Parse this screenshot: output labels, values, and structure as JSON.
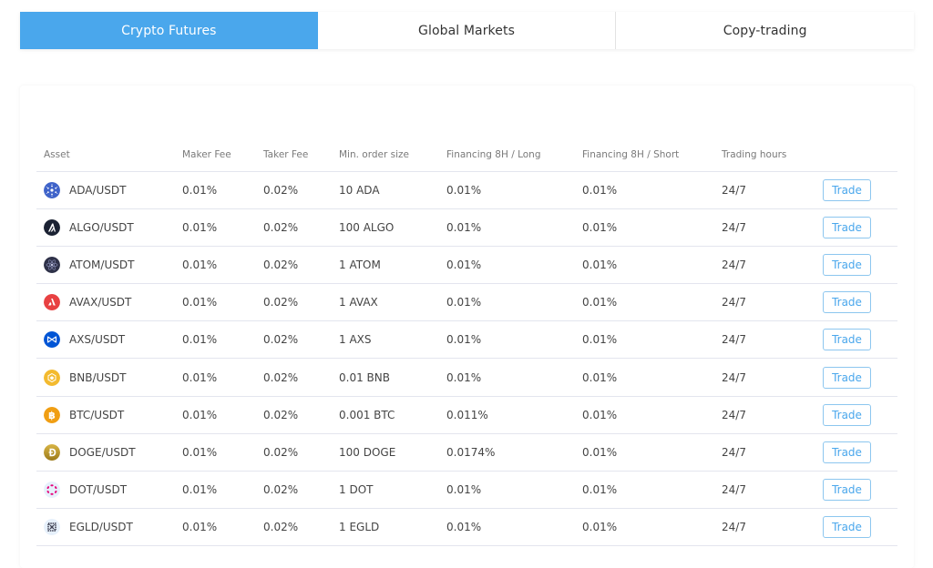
{
  "tabs": [
    {
      "label": "Crypto Futures",
      "active": true
    },
    {
      "label": "Global Markets",
      "active": false
    },
    {
      "label": "Copy-trading",
      "active": false
    }
  ],
  "colors": {
    "accent": "#4aa7ec",
    "trade_border": "#8cc6ef"
  },
  "table": {
    "headers": {
      "asset": "Asset",
      "maker_fee": "Maker Fee",
      "taker_fee": "Taker Fee",
      "min_order": "Min. order size",
      "fin_long": "Financing 8H / Long",
      "fin_short": "Financing 8H / Short",
      "hours": "Trading hours"
    },
    "rows": [
      {
        "icon": "ada-icon",
        "asset": "ADA/USDT",
        "maker_fee": "0.01%",
        "taker_fee": "0.02%",
        "min_order": "10 ADA",
        "fin_long": "0.01%",
        "fin_short": "0.01%",
        "hours": "24/7",
        "action": "Trade"
      },
      {
        "icon": "algo-icon",
        "asset": "ALGO/USDT",
        "maker_fee": "0.01%",
        "taker_fee": "0.02%",
        "min_order": "100 ALGO",
        "fin_long": "0.01%",
        "fin_short": "0.01%",
        "hours": "24/7",
        "action": "Trade"
      },
      {
        "icon": "atom-icon",
        "asset": "ATOM/USDT",
        "maker_fee": "0.01%",
        "taker_fee": "0.02%",
        "min_order": "1 ATOM",
        "fin_long": "0.01%",
        "fin_short": "0.01%",
        "hours": "24/7",
        "action": "Trade"
      },
      {
        "icon": "avax-icon",
        "asset": "AVAX/USDT",
        "maker_fee": "0.01%",
        "taker_fee": "0.02%",
        "min_order": "1 AVAX",
        "fin_long": "0.01%",
        "fin_short": "0.01%",
        "hours": "24/7",
        "action": "Trade"
      },
      {
        "icon": "axs-icon",
        "asset": "AXS/USDT",
        "maker_fee": "0.01%",
        "taker_fee": "0.02%",
        "min_order": "1 AXS",
        "fin_long": "0.01%",
        "fin_short": "0.01%",
        "hours": "24/7",
        "action": "Trade"
      },
      {
        "icon": "bnb-icon",
        "asset": "BNB/USDT",
        "maker_fee": "0.01%",
        "taker_fee": "0.02%",
        "min_order": "0.01 BNB",
        "fin_long": "0.01%",
        "fin_short": "0.01%",
        "hours": "24/7",
        "action": "Trade"
      },
      {
        "icon": "btc-icon",
        "asset": "BTC/USDT",
        "maker_fee": "0.01%",
        "taker_fee": "0.02%",
        "min_order": "0.001 BTC",
        "fin_long": "0.011%",
        "fin_short": "0.01%",
        "hours": "24/7",
        "action": "Trade"
      },
      {
        "icon": "doge-icon",
        "asset": "DOGE/USDT",
        "maker_fee": "0.01%",
        "taker_fee": "0.02%",
        "min_order": "100 DOGE",
        "fin_long": "0.0174%",
        "fin_short": "0.01%",
        "hours": "24/7",
        "action": "Trade"
      },
      {
        "icon": "dot-icon",
        "asset": "DOT/USDT",
        "maker_fee": "0.01%",
        "taker_fee": "0.02%",
        "min_order": "1 DOT",
        "fin_long": "0.01%",
        "fin_short": "0.01%",
        "hours": "24/7",
        "action": "Trade"
      },
      {
        "icon": "egld-icon",
        "asset": "EGLD/USDT",
        "maker_fee": "0.01%",
        "taker_fee": "0.02%",
        "min_order": "1 EGLD",
        "fin_long": "0.01%",
        "fin_short": "0.01%",
        "hours": "24/7",
        "action": "Trade"
      }
    ]
  }
}
